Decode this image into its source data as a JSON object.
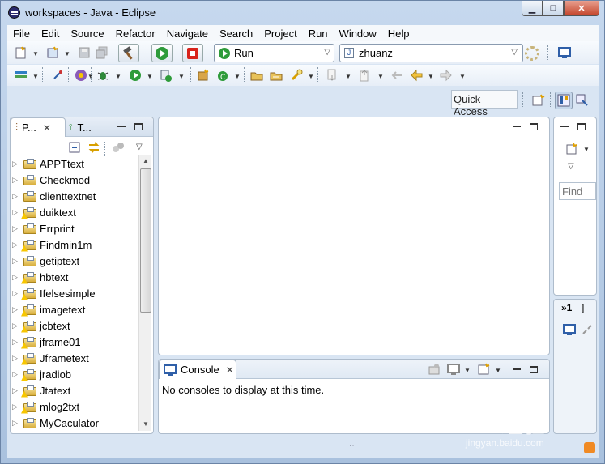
{
  "window": {
    "title": "workspaces - Java - Eclipse",
    "controls": {
      "minimize": "▁",
      "maximize": "□",
      "close": "✕"
    }
  },
  "menu": [
    "File",
    "Edit",
    "Source",
    "Refactor",
    "Navigate",
    "Search",
    "Project",
    "Run",
    "Window",
    "Help"
  ],
  "launch_toolbar": {
    "mode_value": "Run",
    "target_value": "zhuanz",
    "target_icon_text": "J"
  },
  "quick_access": {
    "label": "Quick Access"
  },
  "package_explorer": {
    "tab_label": "P...",
    "second_tab_label": "T...",
    "projects": [
      {
        "name": "APPTtext",
        "warning": false
      },
      {
        "name": "Checkmod",
        "warning": false
      },
      {
        "name": "clienttextnet",
        "warning": false
      },
      {
        "name": "duiktext",
        "warning": true
      },
      {
        "name": "Errprint",
        "warning": false
      },
      {
        "name": "Findmin1m",
        "warning": true
      },
      {
        "name": "getiptext",
        "warning": false
      },
      {
        "name": "hbtext",
        "warning": true
      },
      {
        "name": "Ifelsesimple",
        "warning": true
      },
      {
        "name": "imagetext",
        "warning": true
      },
      {
        "name": "jcbtext",
        "warning": true
      },
      {
        "name": "jframe01",
        "warning": true
      },
      {
        "name": "Jframetext",
        "warning": true
      },
      {
        "name": "jradiob",
        "warning": true
      },
      {
        "name": "Jtatext",
        "warning": true
      },
      {
        "name": "mlog2txt",
        "warning": true
      },
      {
        "name": "MyCaculator",
        "warning": false
      }
    ]
  },
  "outline": {
    "find_placeholder": "Find",
    "collapsed_count": "»1"
  },
  "console": {
    "tab_label": "Console",
    "message": "No consoles to display at this time."
  },
  "watermark": {
    "logo": "Bai 经验",
    "url": "jingyan.baidu.com"
  },
  "colors": {
    "accent": "#2f5fa8",
    "run_green": "#2e9b3a",
    "stop_red": "#d8231b",
    "chrome_bg": "#d9e5f3"
  }
}
